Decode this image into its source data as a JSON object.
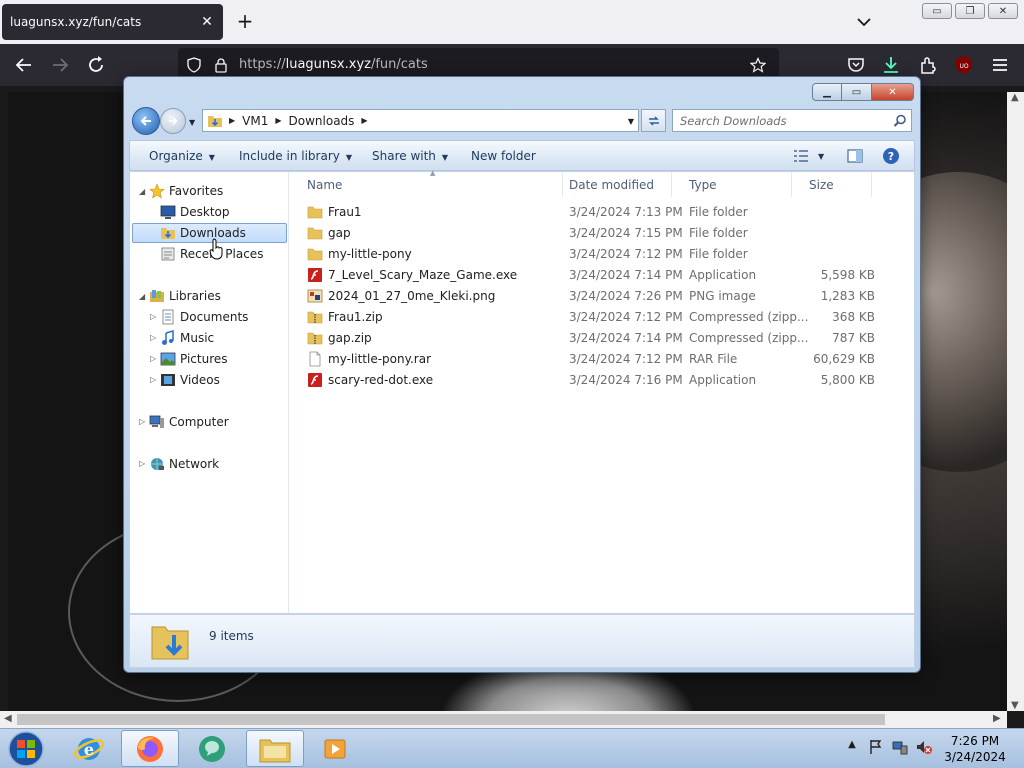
{
  "browser": {
    "tab_title": "luagunsx.xyz/fun/cats",
    "url_prefix": "https://",
    "url_domain": "luagunsx.xyz",
    "url_path": "/fun/cats"
  },
  "explorer": {
    "breadcrumb": [
      "VM1",
      "Downloads"
    ],
    "search_placeholder": "Search Downloads",
    "commands": {
      "organize": "Organize",
      "include_in_library": "Include in library",
      "share_with": "Share with",
      "new_folder": "New folder"
    },
    "nav": {
      "favorites": "Favorites",
      "desktop": "Desktop",
      "downloads": "Downloads",
      "recent_places": "Recent Places",
      "libraries": "Libraries",
      "documents": "Documents",
      "music": "Music",
      "pictures": "Pictures",
      "videos": "Videos",
      "computer": "Computer",
      "network": "Network"
    },
    "columns": {
      "name": "Name",
      "date_modified": "Date modified",
      "type": "Type",
      "size": "Size"
    },
    "files": [
      {
        "name": "Frau1",
        "date": "3/24/2024 7:13 PM",
        "type": "File folder",
        "size": "",
        "icon": "folder-icon"
      },
      {
        "name": "gap",
        "date": "3/24/2024 7:15 PM",
        "type": "File folder",
        "size": "",
        "icon": "folder-icon"
      },
      {
        "name": "my-little-pony",
        "date": "3/24/2024 7:12 PM",
        "type": "File folder",
        "size": "",
        "icon": "folder-icon"
      },
      {
        "name": "7_Level_Scary_Maze_Game.exe",
        "date": "3/24/2024 7:14 PM",
        "type": "Application",
        "size": "5,598 KB",
        "icon": "flash-exe-icon"
      },
      {
        "name": "2024_01_27_0me_Kleki.png",
        "date": "3/24/2024 7:26 PM",
        "type": "PNG image",
        "size": "1,283 KB",
        "icon": "image-file-icon"
      },
      {
        "name": "Frau1.zip",
        "date": "3/24/2024 7:12 PM",
        "type": "Compressed (zipp...",
        "size": "368 KB",
        "icon": "zip-folder-icon"
      },
      {
        "name": "gap.zip",
        "date": "3/24/2024 7:14 PM",
        "type": "Compressed (zipp...",
        "size": "787 KB",
        "icon": "zip-folder-icon"
      },
      {
        "name": "my-little-pony.rar",
        "date": "3/24/2024 7:12 PM",
        "type": "RAR File",
        "size": "60,629 KB",
        "icon": "blank-file-icon"
      },
      {
        "name": "scary-red-dot.exe",
        "date": "3/24/2024 7:16 PM",
        "type": "Application",
        "size": "5,800 KB",
        "icon": "flash-exe-icon"
      }
    ],
    "status_count": "9 items"
  },
  "taskbar": {
    "time": "7:26 PM",
    "date": "3/24/2024"
  }
}
